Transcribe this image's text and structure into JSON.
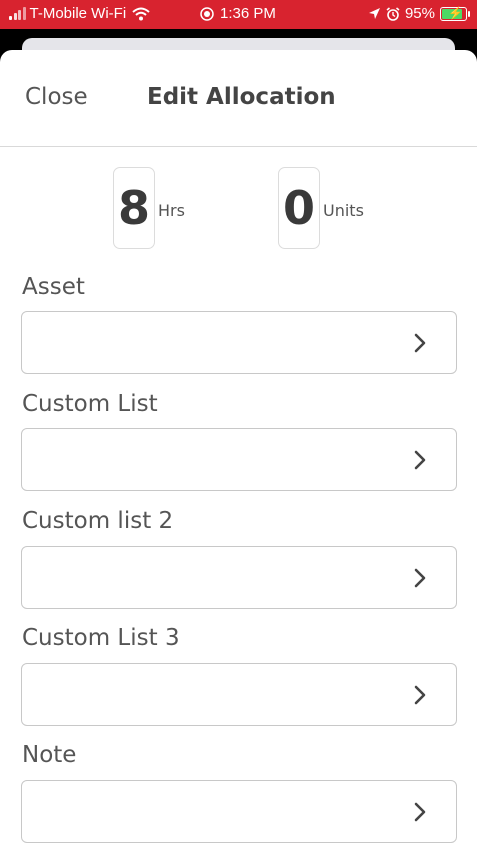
{
  "status_bar": {
    "carrier": "T-Mobile Wi-Fi",
    "time": "1:36 PM",
    "battery": "95%",
    "battery_level": 0.95,
    "accent_color": "#d8232f"
  },
  "header": {
    "close_label": "Close",
    "title": "Edit Allocation"
  },
  "counters": {
    "hours_value": "8",
    "hours_label": "Hrs",
    "units_value": "0",
    "units_label": "Units"
  },
  "fields": [
    {
      "label": "Asset",
      "value": ""
    },
    {
      "label": "Custom List",
      "value": ""
    },
    {
      "label": "Custom list 2",
      "value": ""
    },
    {
      "label": "Custom List 3",
      "value": ""
    },
    {
      "label": "Note",
      "value": ""
    }
  ],
  "icons": [
    "wifi-icon",
    "alarm-icon",
    "location-icon",
    "chevron-right-icon",
    "charging-bolt-icon"
  ]
}
